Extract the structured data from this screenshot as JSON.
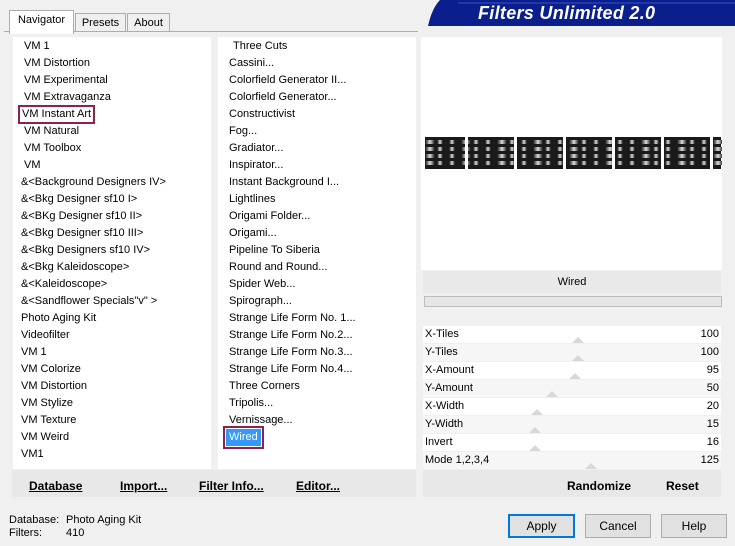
{
  "tabs": [
    {
      "label": "Navigator",
      "active": true
    },
    {
      "label": "Presets",
      "active": false
    },
    {
      "label": "About",
      "active": false
    }
  ],
  "title": "Filters Unlimited 2.0",
  "categories": [
    "VM 1",
    "VM Distortion",
    "VM Experimental",
    "VM Extravaganza",
    "VM Instant Art",
    "VM Natural",
    "VM Toolbox",
    "VM",
    "&<Background Designers IV>",
    "&<Bkg Designer sf10 I>",
    "&<BKg Designer sf10 II>",
    "&<Bkg Designer sf10 III>",
    "&<Bkg Designers sf10 IV>",
    "&<Bkg Kaleidoscope>",
    "&<Kaleidoscope>",
    "&<Sandflower Specials\"v\" >",
    "Photo Aging Kit",
    "Videofilter",
    "VM 1",
    "VM Colorize",
    "VM Distortion",
    "VM Stylize",
    "VM Texture",
    "VM Weird",
    "VM1"
  ],
  "filters": [
    "Three Cuts",
    "Cassini...",
    "Colorfield Generator II...",
    "Colorfield Generator...",
    "Constructivist",
    "Fog...",
    "Gradiator...",
    "Inspirator...",
    "Instant Background I...",
    "Lightlines",
    "Origami Folder...",
    "Origami...",
    "Pipeline To Siberia",
    "Round and Round...",
    "Spider Web...",
    "Spirograph...",
    "Strange Life Form No. 1...",
    "Strange Life Form No.2...",
    "Strange Life Form No.3...",
    "Strange Life Form No.4...",
    "Three Corners",
    "Tripolis...",
    "Vernissage...",
    "Wired"
  ],
  "list_buttons": {
    "database": "Database",
    "import": "Import...",
    "filter_info": "Filter Info...",
    "editor": "Editor..."
  },
  "selected_filter_name": "Wired",
  "params": [
    {
      "label": "X-Tiles",
      "value": "100"
    },
    {
      "label": "Y-Tiles",
      "value": "100"
    },
    {
      "label": "X-Amount",
      "value": "95"
    },
    {
      "label": "Y-Amount",
      "value": "50"
    },
    {
      "label": "X-Width",
      "value": "20"
    },
    {
      "label": "Y-Width",
      "value": "15"
    },
    {
      "label": "Invert",
      "value": "16"
    },
    {
      "label": "Mode 1,2,3,4",
      "value": "125"
    }
  ],
  "actions": {
    "randomize": "Randomize",
    "reset": "Reset"
  },
  "footer": {
    "database_label": "Database:",
    "database_value": "Photo Aging Kit",
    "filters_label": "Filters:",
    "filters_value": "410"
  },
  "dialog_buttons": {
    "apply": "Apply",
    "cancel": "Cancel",
    "help": "Help"
  },
  "colors": {
    "banner": "#0a1e8c",
    "selection": "#3399ff",
    "highlight_box": "#8b2252"
  }
}
